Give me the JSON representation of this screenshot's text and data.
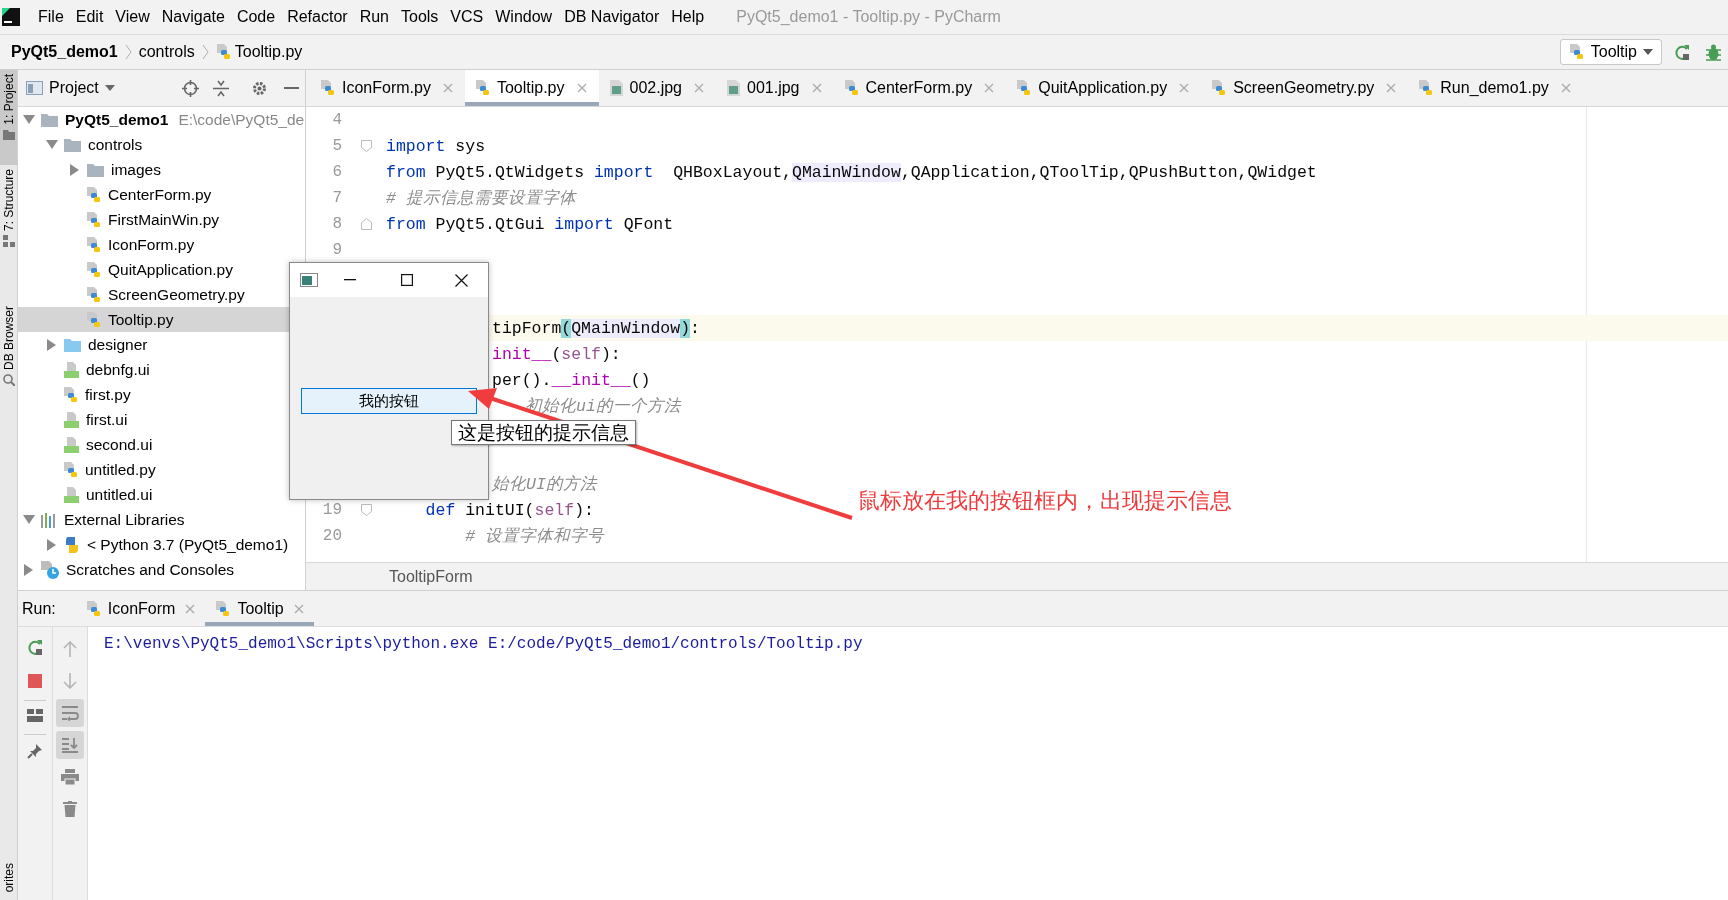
{
  "menu_bar": {
    "items": [
      "File",
      "Edit",
      "View",
      "Navigate",
      "Code",
      "Refactor",
      "Run",
      "Tools",
      "VCS",
      "Window",
      "DB Navigator",
      "Help"
    ],
    "window_title": "PyQt5_demo1 - Tooltip.py - PyCharm"
  },
  "nav_bar": {
    "crumbs": [
      {
        "label": "PyQt5_demo1",
        "kind": "project"
      },
      {
        "label": "controls",
        "kind": "folder"
      },
      {
        "label": "Tooltip.py",
        "kind": "python"
      }
    ],
    "run_config": "Tooltip"
  },
  "side_stripe": {
    "tabs": [
      {
        "label": "1: Project",
        "kind": "project",
        "selected": true
      },
      {
        "label": "7: Structure",
        "kind": "structure",
        "selected": false
      },
      {
        "label": "DB Browser",
        "kind": "db",
        "selected": false
      },
      {
        "label": "orites",
        "kind": "plain",
        "selected": false
      }
    ]
  },
  "project_panel": {
    "title": "Project",
    "tree": [
      {
        "label": "PyQt5_demo1",
        "hint": "E:\\code\\PyQt5_de",
        "kind": "project",
        "expanded": true,
        "selected": false,
        "children": [
          {
            "label": "controls",
            "kind": "folder",
            "expanded": true,
            "selected": false,
            "children": [
              {
                "label": "images",
                "kind": "folder",
                "expanded": false,
                "selected": false
              },
              {
                "label": "CenterForm.py",
                "kind": "python",
                "selected": false
              },
              {
                "label": "FirstMainWin.py",
                "kind": "python",
                "selected": false
              },
              {
                "label": "IconForm.py",
                "kind": "python",
                "selected": false
              },
              {
                "label": "QuitApplication.py",
                "kind": "python",
                "selected": false
              },
              {
                "label": "ScreenGeometry.py",
                "kind": "python",
                "selected": false
              },
              {
                "label": "Tooltip.py",
                "kind": "python",
                "selected": true
              }
            ]
          },
          {
            "label": "designer",
            "kind": "source-folder",
            "expanded": false,
            "selected": false
          },
          {
            "label": "debnfg.ui",
            "kind": "qt",
            "selected": false
          },
          {
            "label": "first.py",
            "kind": "python",
            "selected": false
          },
          {
            "label": "first.ui",
            "kind": "qt",
            "selected": false
          },
          {
            "label": "second.ui",
            "kind": "qt",
            "selected": false
          },
          {
            "label": "untitled.py",
            "kind": "python",
            "selected": false
          },
          {
            "label": "untitled.ui",
            "kind": "qt",
            "selected": false
          }
        ]
      },
      {
        "label": "External Libraries",
        "kind": "libraries",
        "expanded": true,
        "selected": false,
        "children": [
          {
            "label": "< Python 3.7 (PyQt5_demo1)",
            "kind": "sdk",
            "expanded": false,
            "selected": false
          }
        ]
      },
      {
        "label": "Scratches and Consoles",
        "kind": "scratches",
        "expanded": false,
        "selected": false
      }
    ]
  },
  "editor": {
    "tabs": [
      {
        "label": "IconForm.py",
        "kind": "python",
        "selected": false
      },
      {
        "label": "Tooltip.py",
        "kind": "python",
        "selected": true
      },
      {
        "label": "002.jpg",
        "kind": "image",
        "selected": false
      },
      {
        "label": "001.jpg",
        "kind": "image",
        "selected": false
      },
      {
        "label": "CenterForm.py",
        "kind": "python",
        "selected": false
      },
      {
        "label": "QuitApplication.py",
        "kind": "python",
        "selected": false
      },
      {
        "label": "ScreenGeometry.py",
        "kind": "python",
        "selected": false
      },
      {
        "label": "Run_demo1.py",
        "kind": "python",
        "selected": false
      }
    ],
    "lines": [
      {
        "number": "4"
      },
      {
        "number": "5",
        "fold_start": true,
        "tokens": [
          {
            "kind": "keyword",
            "text": "import"
          },
          {
            "kind": "plain",
            "text": " sys"
          }
        ]
      },
      {
        "number": "6",
        "tokens": [
          {
            "kind": "keyword",
            "text": "from"
          },
          {
            "kind": "plain",
            "text": " PyQt5.QtWidgets "
          },
          {
            "kind": "keyword",
            "text": "import"
          },
          {
            "kind": "plain",
            "text": "  QHBoxLayout,"
          },
          {
            "kind": "usage",
            "text": "QMainWindow"
          },
          {
            "kind": "plain",
            "text": ",QApplication,QToolTip,QPushButton,QWidget"
          }
        ]
      },
      {
        "number": "7",
        "tokens": [
          {
            "kind": "comment",
            "text": "# 提示信息需要设置字体"
          }
        ]
      },
      {
        "number": "8",
        "fold_end": true,
        "tokens": [
          {
            "kind": "keyword",
            "text": "from"
          },
          {
            "kind": "plain",
            "text": " PyQt5.QtGui "
          },
          {
            "kind": "keyword",
            "text": "import"
          },
          {
            "kind": "plain",
            "text": " QFont"
          }
        ]
      },
      {
        "number": "9"
      },
      {
        "covered": true,
        "current": true,
        "tokens": [
          {
            "kind": "plain",
            "text": "tipForm"
          },
          {
            "kind": "brace",
            "text": "("
          },
          {
            "kind": "usage",
            "text": "QMainWindow"
          },
          {
            "kind": "brace",
            "text": ")"
          },
          {
            "kind": "plain",
            "text": ":"
          }
        ]
      },
      {
        "covered": true,
        "tokens": [
          {
            "kind": "magic",
            "text": "init__"
          },
          {
            "kind": "plain",
            "text": "("
          },
          {
            "kind": "self",
            "text": "self"
          },
          {
            "kind": "plain",
            "text": "):"
          }
        ]
      },
      {
        "covered": true,
        "tokens": [
          {
            "kind": "plain",
            "text": "per()."
          },
          {
            "kind": "magic",
            "text": "__init__"
          },
          {
            "kind": "plain",
            "text": "()"
          }
        ]
      },
      {
        "covered": true,
        "under_arrow": true,
        "tokens": [
          {
            "kind": "comment",
            "text": "初始化ui的一个方法"
          }
        ]
      },
      {
        "covered": true,
        "tokens": [
          {
            "kind": "comment",
            "text": "始化UI的方法"
          }
        ]
      },
      {
        "number": "19",
        "fold_start": true,
        "tokens": [
          {
            "kind": "keyword",
            "text": "    def"
          },
          {
            "kind": "plain",
            "text": " initUI("
          },
          {
            "kind": "self",
            "text": "self"
          },
          {
            "kind": "plain",
            "text": "):"
          }
        ]
      },
      {
        "number": "20",
        "tokens": [
          {
            "kind": "comment",
            "text": "        # 设置字体和字号"
          }
        ]
      }
    ],
    "breadcrumb": "TooltipForm"
  },
  "run_panel": {
    "label": "Run:",
    "tabs": [
      {
        "label": "IconForm",
        "selected": false
      },
      {
        "label": "Tooltip",
        "selected": true
      }
    ],
    "tools": [
      {
        "kind": "up",
        "on": false
      },
      {
        "kind": "down",
        "on": false
      },
      {
        "kind": "wrap",
        "on": true
      },
      {
        "kind": "scroll-end",
        "on": true
      },
      {
        "kind": "print",
        "on": false
      },
      {
        "kind": "trash",
        "on": false
      }
    ],
    "console": [
      "E:\\venvs\\PyQt5_demo1\\Scripts\\python.exe E:/code/PyQt5_demo1/controls/Tooltip.py"
    ]
  },
  "app_window": {
    "button": "我的按钮",
    "tooltip": "这是按钮的提示信息"
  },
  "annotation": {
    "text": "鼠标放在我的按钮框内，出现提示信息"
  }
}
